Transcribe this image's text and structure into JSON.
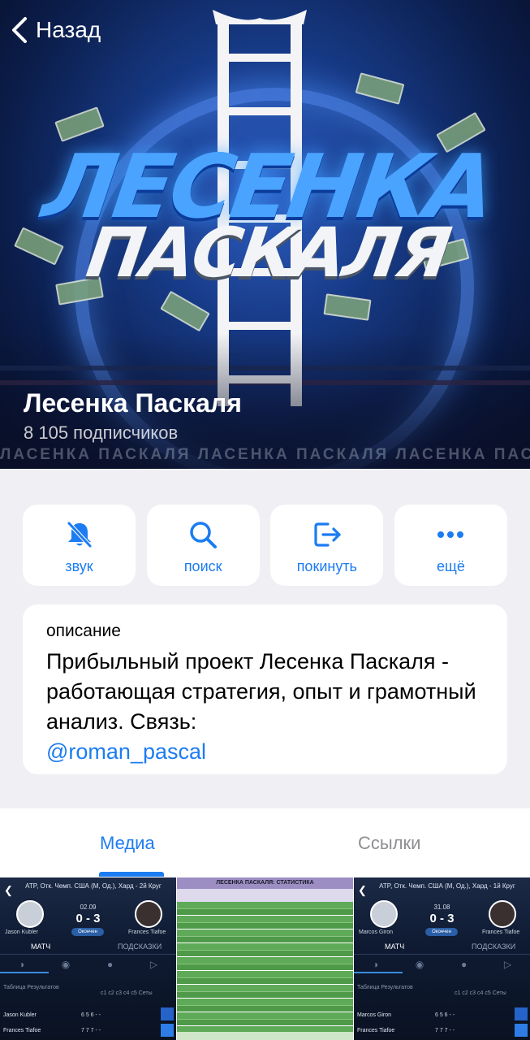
{
  "header": {
    "back_label": "Назад",
    "logo_line1": "ЛЕСЕНКА",
    "logo_line2": "ПАСКАЛЯ",
    "channel_name": "Лесенка Паскаля",
    "subscribers": "8 105 подписчиков",
    "watermark": "ЛАСЕНКА ПАСКАЛЯ ЛАСЕНКА ПАСКАЛЯ ЛАСЕНКА ПАСКАЛЯ ЛАСЕНКА ПАСКАЛЯ"
  },
  "actions": [
    {
      "label": "звук",
      "icon": "bell-slash-icon"
    },
    {
      "label": "поиск",
      "icon": "search-icon"
    },
    {
      "label": "покинуть",
      "icon": "leave-icon"
    },
    {
      "label": "ещё",
      "icon": "more-icon"
    }
  ],
  "description": {
    "title": "описание",
    "text": "Прибыльный проект Лесенка Паскаля - работающая стратегия, опыт и грамотный анализ. Связь:",
    "link": "@roman_pascal"
  },
  "tabs": {
    "media": "Медиа",
    "links": "Ссылки"
  },
  "colors": {
    "accent": "#1c7cf2",
    "background": "#efeff4"
  },
  "media": [
    {
      "title": "ATP, Отк. Чемп. США (М, Од.), Хард - 2й Круг",
      "date": "02.09",
      "score": "0 - 3",
      "status": "Окончен",
      "player1": "Jason Kubler",
      "player2": "Frances Tiafoe",
      "tab_match": "МАТЧ",
      "tab_hints": "ПОДСКАЗКИ",
      "table_title": "Таблица Результатов",
      "set_headers": "с1  с2  с3  с4  с5  Сеты",
      "row1_cells": "6  5  6  -  -",
      "row2_cells": "7  7  7  -  -"
    },
    {
      "title": "ЛЕСЕНКА ПАСКАЛЯ: СТАТИСТИКА"
    },
    {
      "title": "ATP, Отк. Чемп. США (М, Од.), Хард - 1й Круг",
      "date": "31.08",
      "score": "0 - 3",
      "status": "Окончен",
      "player1": "Marcos Giron",
      "player2": "Frances Tiafoe",
      "tab_match": "МАТЧ",
      "tab_hints": "ПОДСКАЗКИ",
      "table_title": "Таблица Результатов",
      "set_headers": "с1  с2  с3  с4  с5  Сеты",
      "row1_cells": "6  5  6  -  -",
      "row2_cells": "7  7  7  -  -"
    }
  ]
}
